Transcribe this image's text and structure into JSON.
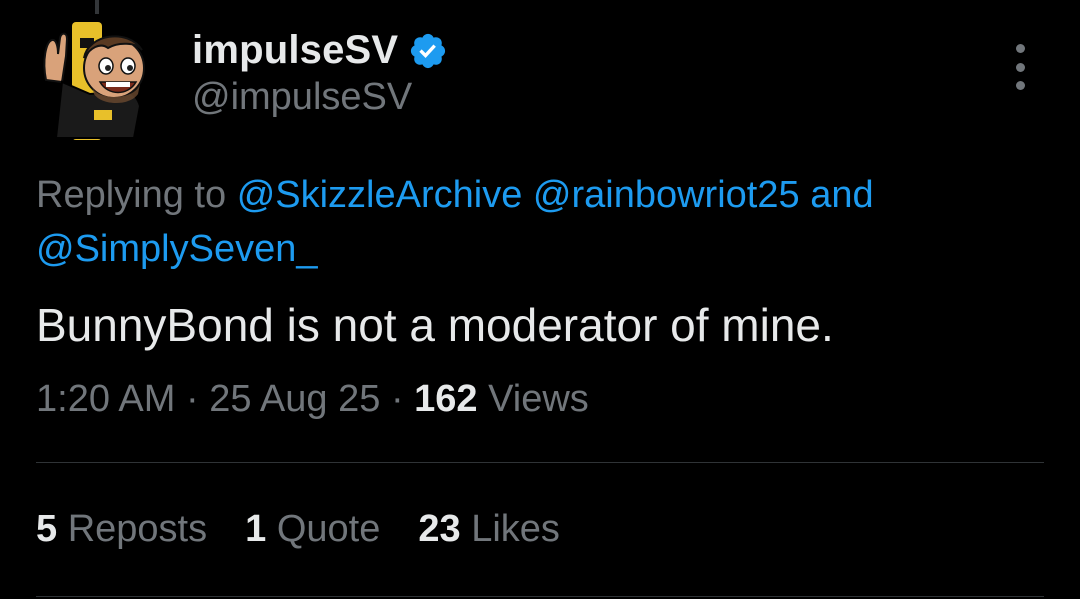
{
  "author": {
    "display_name": "impulseSV",
    "handle": "@impulseSV",
    "verified_icon": "verified-badge-icon",
    "avatar_icon": "avatar-icon"
  },
  "reply": {
    "prefix": "Replying to",
    "mention_1": "@SkizzleArchive",
    "mention_2": "@rainbowriot25",
    "joiner": "and",
    "mention_3": "@SimplySeven_"
  },
  "tweet": {
    "text": "BunnyBond is not a moderator of mine."
  },
  "meta": {
    "time": "1:20 AM",
    "sep1": "·",
    "date": "25 Aug 25",
    "sep2": "·",
    "views_count": "162",
    "views_label": "Views"
  },
  "stats": {
    "reposts_count": "5",
    "reposts_label": "Reposts",
    "quotes_count": "1",
    "quotes_label": "Quote",
    "likes_count": "23",
    "likes_label": "Likes"
  },
  "colors": {
    "background": "#000000",
    "text_primary": "#e7e9ea",
    "text_secondary": "#71767b",
    "accent": "#1d9bf0",
    "divider": "#2f3336"
  }
}
